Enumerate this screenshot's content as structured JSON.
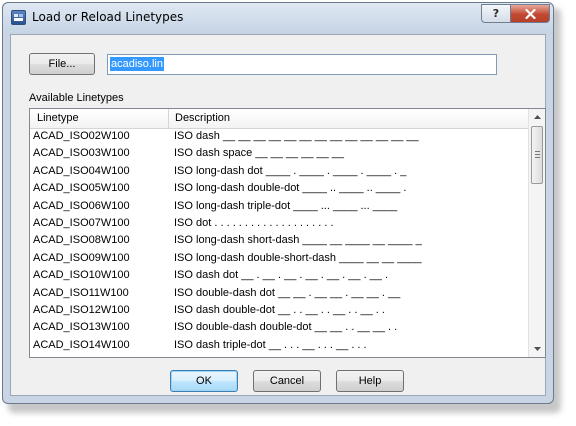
{
  "window": {
    "title": "Load or Reload Linetypes",
    "help_label": "?",
    "close_icon": "close-icon"
  },
  "file": {
    "button_label": "File...",
    "value": "acadiso.lin"
  },
  "list": {
    "group_label": "Available Linetypes",
    "columns": [
      "Linetype",
      "Description"
    ],
    "rows": [
      {
        "name": "ACAD_ISO02W100",
        "description": "ISO dash __ __ __ __ __ __ __ __ __ __ __ __ __"
      },
      {
        "name": "ACAD_ISO03W100",
        "description": "ISO dash space __    __    __    __    __    __"
      },
      {
        "name": "ACAD_ISO04W100",
        "description": "ISO long-dash dot ____ . ____ . ____ . ____ . _"
      },
      {
        "name": "ACAD_ISO05W100",
        "description": "ISO long-dash double-dot ____ .. ____ .. ____ ."
      },
      {
        "name": "ACAD_ISO06W100",
        "description": "ISO long-dash triple-dot ____ ... ____ ... ____"
      },
      {
        "name": "ACAD_ISO07W100",
        "description": "ISO dot . . . . . . . . . . . . . . . . . . . ."
      },
      {
        "name": "ACAD_ISO08W100",
        "description": "ISO long-dash short-dash ____ __ ____ __ ____ _"
      },
      {
        "name": "ACAD_ISO09W100",
        "description": "ISO long-dash double-short-dash ____ __ __ ____"
      },
      {
        "name": "ACAD_ISO10W100",
        "description": "ISO dash dot __ . __ . __ . __ . __ . __ . __ ."
      },
      {
        "name": "ACAD_ISO11W100",
        "description": "ISO double-dash dot __ __ . __ __ . __ __ . __"
      },
      {
        "name": "ACAD_ISO12W100",
        "description": "ISO dash double-dot __ . . __ . . __ . . __ . ."
      },
      {
        "name": "ACAD_ISO13W100",
        "description": "ISO double-dash double-dot __ __ . . __ __ . ."
      },
      {
        "name": "ACAD_ISO14W100",
        "description": "ISO dash triple-dot __ . . . __ . . . __ . . ."
      }
    ],
    "scrollbar_position": 0.0
  },
  "buttons": {
    "ok": "OK",
    "cancel": "Cancel",
    "help": "Help"
  }
}
